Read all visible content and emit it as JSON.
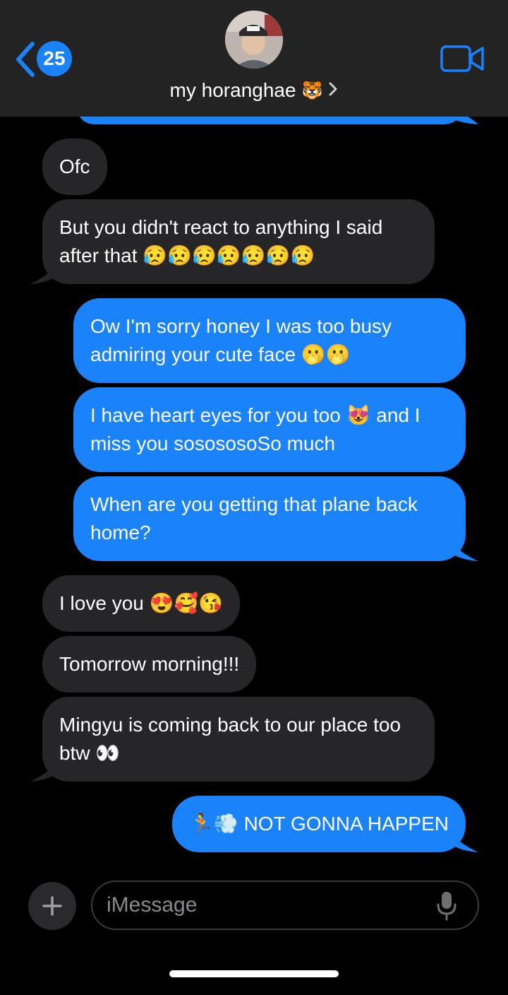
{
  "header": {
    "back_count": "25",
    "contact_name": "my horanghae",
    "contact_emoji": "🐯"
  },
  "messages": [
    {
      "direction": "in",
      "text": "Ofc"
    },
    {
      "direction": "in",
      "text": "But you didn't react to anything I said after that 😥😥😥😥😥😥😥"
    },
    {
      "direction": "out",
      "text": "Ow I'm sorry honey I was too busy admiring your cute face 🫢🫢"
    },
    {
      "direction": "out",
      "text": "I have heart eyes for you too 😻 and I miss you sosososoSo much"
    },
    {
      "direction": "out",
      "text": "When are you getting that plane back home?"
    },
    {
      "direction": "in",
      "text": "I love you 😍🥰😘"
    },
    {
      "direction": "in",
      "text": "Tomorrow morning!!!"
    },
    {
      "direction": "in",
      "text": "Mingyu is coming back to our place too btw 👀"
    },
    {
      "direction": "out",
      "text": "🏃💨 NOT GONNA HAPPEN"
    }
  ],
  "composer": {
    "placeholder": "iMessage"
  },
  "colors": {
    "outgoing": "#1a82fb",
    "incoming": "#262628",
    "header_bg": "#232323"
  },
  "icons": [
    "chevron-left-icon",
    "video-camera-icon",
    "plus-icon",
    "microphone-icon"
  ]
}
